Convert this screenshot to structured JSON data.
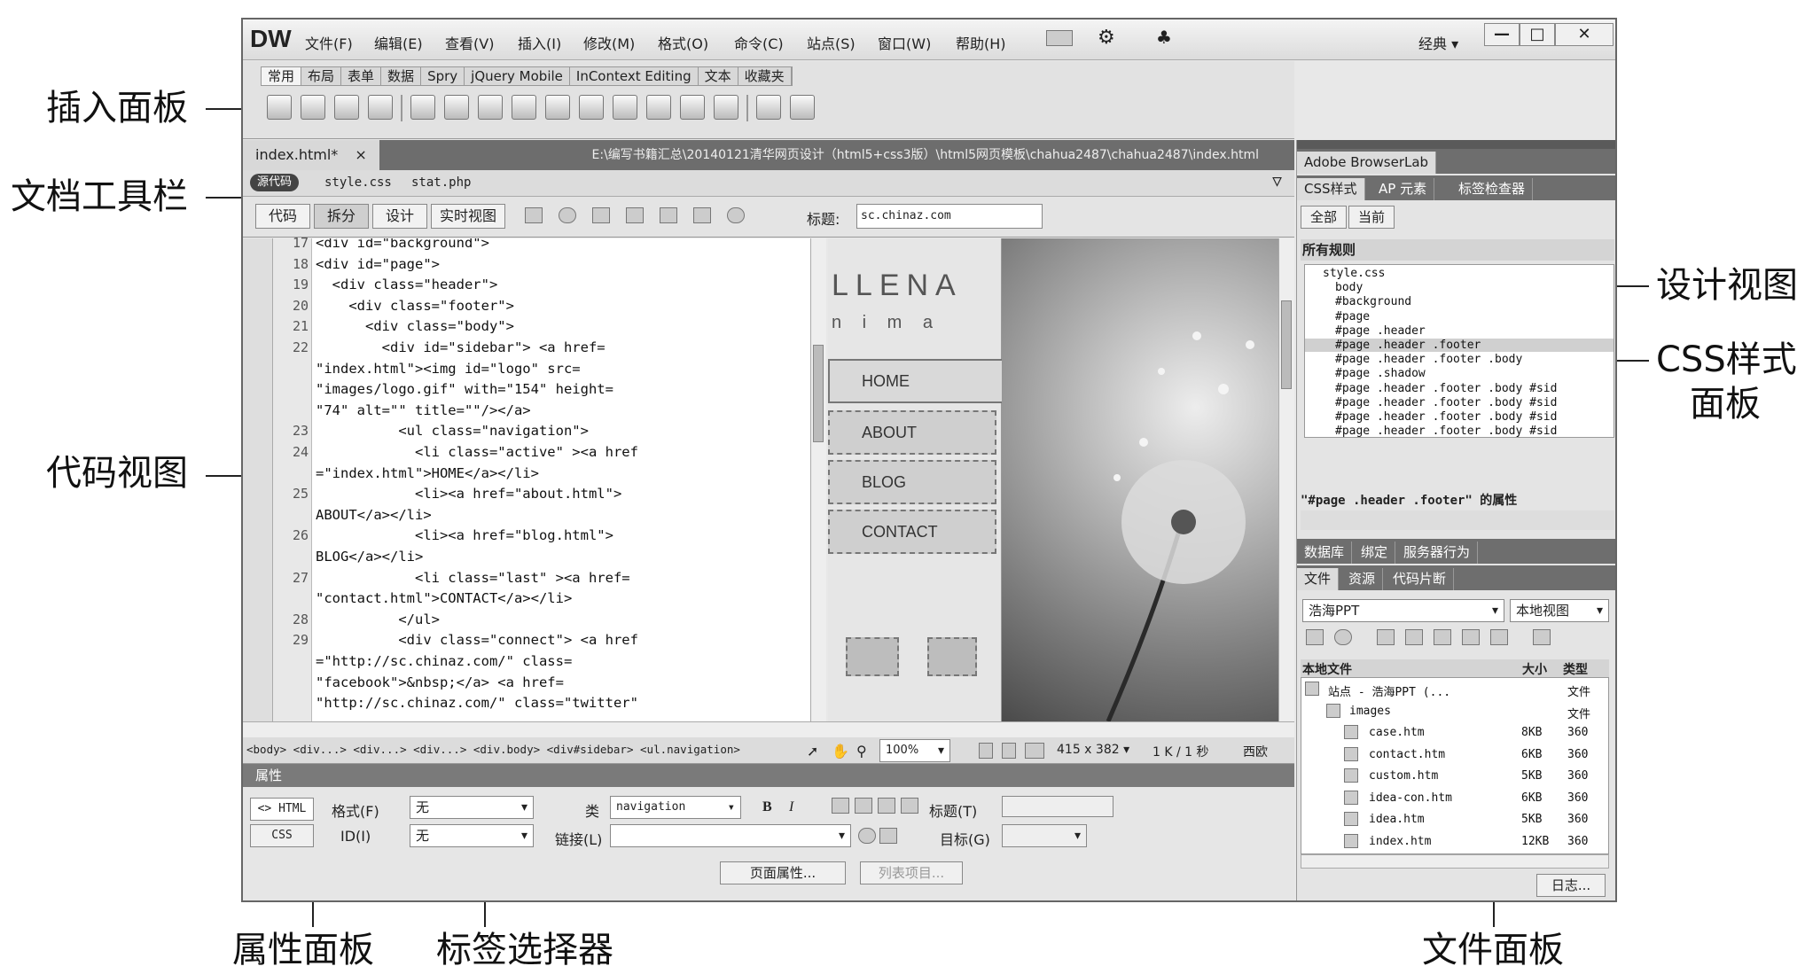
{
  "callouts": {
    "insert_panel": "插入面板",
    "doc_toolbar": "文档工具栏",
    "code_view": "代码视图",
    "design_view": "设计视图",
    "css_panel_l1": "CSS样式",
    "css_panel_l2": "面板",
    "property_panel": "属性面板",
    "tag_selector": "标签选择器",
    "files_panel": "文件面板"
  },
  "app": {
    "logo": "DW",
    "menus": [
      "文件(F)",
      "编辑(E)",
      "查看(V)",
      "插入(I)",
      "修改(M)",
      "格式(O)",
      "命令(C)",
      "站点(S)",
      "窗口(W)",
      "帮助(H)"
    ],
    "workspace": "经典 ▾",
    "win_min": "—",
    "win_max": "□",
    "win_close": "✕"
  },
  "insert_tabs": [
    "常用",
    "布局",
    "表单",
    "数据",
    "Spry",
    "jQuery Mobile",
    "InContext Editing",
    "文本",
    "收藏夹"
  ],
  "document": {
    "tab_name": "index.html*",
    "tab_close": "×",
    "path": "E:\\编写书籍汇总\\20140121清华网页设计（html5+css3版）\\html5网页模板\\chahua2487\\chahua2487\\index.html",
    "source_code": "源代码",
    "related": [
      "style.css",
      "stat.php"
    ]
  },
  "doc_toolbar": {
    "code": "代码",
    "split": "拆分",
    "design": "设计",
    "live": "实时视图",
    "title_label": "标题:",
    "title_value": "sc.chinaz.com"
  },
  "code_lines": [
    {
      "n": "17",
      "t": "<div id=\"background\">"
    },
    {
      "n": "18",
      "t": "<div id=\"page\">"
    },
    {
      "n": "19",
      "t": "  <div class=\"header\">"
    },
    {
      "n": "20",
      "t": "    <div class=\"footer\">"
    },
    {
      "n": "21",
      "t": "      <div class=\"body\">"
    },
    {
      "n": "22",
      "t": "        <div id=\"sidebar\"> <a href="
    },
    {
      "n": "",
      "t": "\"index.html\"><img id=\"logo\" src="
    },
    {
      "n": "",
      "t": "\"images/logo.gif\" with=\"154\" height="
    },
    {
      "n": "",
      "t": "\"74\" alt=\"\" title=\"\"/></a>"
    },
    {
      "n": "23",
      "t": "          <ul class=\"navigation\">"
    },
    {
      "n": "24",
      "t": "            <li class=\"active\" ><a href"
    },
    {
      "n": "",
      "t": "=\"index.html\">HOME</a></li>"
    },
    {
      "n": "25",
      "t": "            <li><a href=\"about.html\">"
    },
    {
      "n": "",
      "t": "ABOUT</a></li>"
    },
    {
      "n": "26",
      "t": "            <li><a href=\"blog.html\">"
    },
    {
      "n": "",
      "t": "BLOG</a></li>"
    },
    {
      "n": "27",
      "t": "            <li class=\"last\" ><a href="
    },
    {
      "n": "",
      "t": "\"contact.html\">CONTACT</a></li>"
    },
    {
      "n": "28",
      "t": "          </ul>"
    },
    {
      "n": "29",
      "t": "          <div class=\"connect\"> <a href"
    },
    {
      "n": "",
      "t": "=\"http://sc.chinaz.com/\" class="
    },
    {
      "n": "",
      "t": "\"facebook\">&nbsp;</a> <a href="
    },
    {
      "n": "",
      "t": "\"http://sc.chinaz.com/\" class=\"twitter\""
    }
  ],
  "design_view": {
    "brand": "LLENA",
    "brand_sub": "n i m a",
    "nav": [
      "HOME",
      "ABOUT",
      "BLOG",
      "CONTACT"
    ]
  },
  "status": {
    "tags": "<body> <div...> <div...> <div...> <div.body> <div#sidebar> <ul.navigation>",
    "zoom": "100%",
    "size": "415 x 382 ▾",
    "dl": "1 K / 1 秒",
    "enc": "西欧"
  },
  "properties": {
    "title": "属性",
    "html_btn": "<> HTML",
    "css_btn": "CSS",
    "format_label": "格式(F)",
    "format_value": "无",
    "id_label": "ID(I)",
    "id_value": "无",
    "class_label": "类",
    "class_value": "navigation",
    "link_label": "链接(L)",
    "bold": "B",
    "italic": "I",
    "title_label": "标题(T)",
    "target_label": "目标(G)",
    "page_props": "页面属性...",
    "list_item": "列表项目..."
  },
  "right_panel": {
    "browserlab": "Adobe BrowserLab",
    "css_tabs": [
      "CSS样式",
      "AP 元素",
      "标签检查器"
    ],
    "all": "全部",
    "current": "当前",
    "all_rules": "所有规则",
    "rules": [
      "style.css",
      "body",
      "#background",
      "#page",
      "#page .header",
      "#page .header .footer",
      "#page .header .footer .body",
      "#page .shadow",
      "#page .header .footer .body #sid",
      "#page .header .footer .body #sid",
      "#page .header .footer .body #sid",
      "#page .header .footer .body #sid"
    ],
    "props_of": "\"#page .header .footer\" 的属性",
    "db_tabs": [
      "数据库",
      "绑定",
      "服务器行为"
    ],
    "file_tabs": [
      "文件",
      "资源",
      "代码片断"
    ],
    "site": "浩海PPT",
    "view": "本地视图",
    "col_local": "本地文件",
    "col_size": "大小",
    "col_type": "类型",
    "files": [
      {
        "name": "站点 - 浩海PPT (...",
        "size": "",
        "type": "文件"
      },
      {
        "name": "images",
        "size": "",
        "type": "文件"
      },
      {
        "name": "case.htm",
        "size": "8KB",
        "type": "360"
      },
      {
        "name": "contact.htm",
        "size": "6KB",
        "type": "360"
      },
      {
        "name": "custom.htm",
        "size": "5KB",
        "type": "360"
      },
      {
        "name": "idea-con.htm",
        "size": "6KB",
        "type": "360"
      },
      {
        "name": "idea.htm",
        "size": "5KB",
        "type": "360"
      },
      {
        "name": "index.htm",
        "size": "12KB",
        "type": "360"
      }
    ],
    "log": "日志..."
  }
}
